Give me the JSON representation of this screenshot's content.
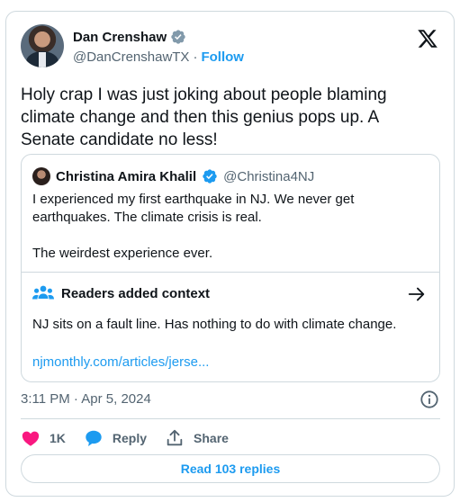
{
  "author": {
    "name": "Dan Crenshaw",
    "handle": "@DanCrenshawTX",
    "separator": "·",
    "follow_label": "Follow"
  },
  "tweet": {
    "text": "Holy crap I was just joking about people blaming climate change and then this genius pops up. A Senate candidate no less!"
  },
  "quoted": {
    "name": "Christina Amira Khalil",
    "handle": "@Christina4NJ",
    "paragraphs": [
      "I experienced my first earthquake in NJ. We never get earthquakes. The climate crisis is real.",
      "The weirdest experience ever."
    ]
  },
  "context": {
    "heading": "Readers added context",
    "text": "NJ sits on a fault line. Has nothing to do with climate change.",
    "link": "njmonthly.com/articles/jerse..."
  },
  "meta": {
    "timestamp": "3:11 PM · Apr 5, 2024"
  },
  "actions": {
    "likes": "1K",
    "reply_label": "Reply",
    "share_label": "Share"
  },
  "read_replies_label": "Read 103 replies",
  "colors": {
    "accent": "#1d9bf0",
    "like": "#f91880",
    "text": "#0f1419",
    "muted": "#536471",
    "border": "#cfd9de"
  },
  "icons": [
    "verified-badge-icon",
    "x-logo-icon",
    "readers-context-icon",
    "arrow-right-icon",
    "info-icon",
    "heart-icon",
    "reply-bubble-icon",
    "share-icon"
  ]
}
